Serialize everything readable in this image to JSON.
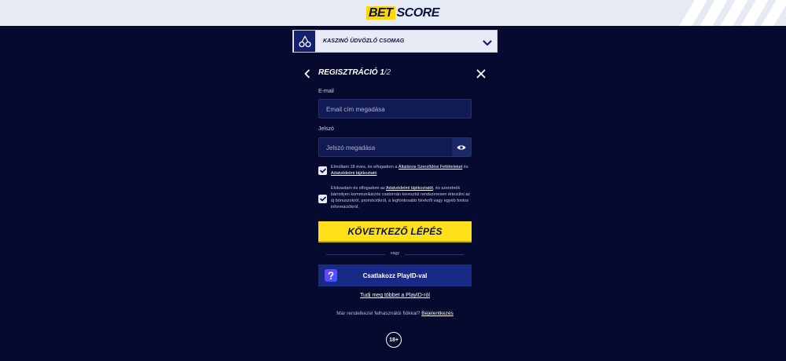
{
  "brand": {
    "logo_bet": "BET",
    "logo_score": "SCORE"
  },
  "bonus": {
    "label": "KASZINÓ ÜDVÖZLŐ CSOMAG",
    "icon": "cherries-icon"
  },
  "form": {
    "title": "REGISZTRÁCIÓ 1",
    "step_suffix": "/2",
    "email_label": "E-mail",
    "email_placeholder": "Email cím megadása",
    "password_label": "Jelszó",
    "password_placeholder": "Jelszó megadása",
    "consent1": {
      "checked": true,
      "text_before": "Elmúltam 18 éves, és elfogadom a ",
      "link1": "Általános Szerződési Feltételeket",
      "text_middle": " és ",
      "link2": "Adatvédelmi tájékoztató"
    },
    "consent2": {
      "checked": true,
      "text_before": "Elolvastam és elfogadom az ",
      "link": "Adatvédelmi tájékoztatót",
      "text_after": ", és szeretnék bármilyen kommunikációs csatornán keresztül rendszeresen értesülni az új bónuszokról, promóciókról, a legfontosabb hírekről vagy egyéb fontos információkról."
    },
    "submit_label": "KÖVETKEZŐ LÉPÉS",
    "or_label": "vagy",
    "playid_label": "Csatlakozz PlayID-val",
    "learn_more": "Tudj meg többet a PlayID-ról",
    "login_prompt": "Már rendelkezel felhasználói fiókkal? ",
    "login_link": "Bejelentkezés",
    "age_badge": "18+"
  },
  "colors": {
    "background": "#060a2e",
    "accent_yellow": "#ffe01b",
    "playid_blue": "#192a86"
  }
}
